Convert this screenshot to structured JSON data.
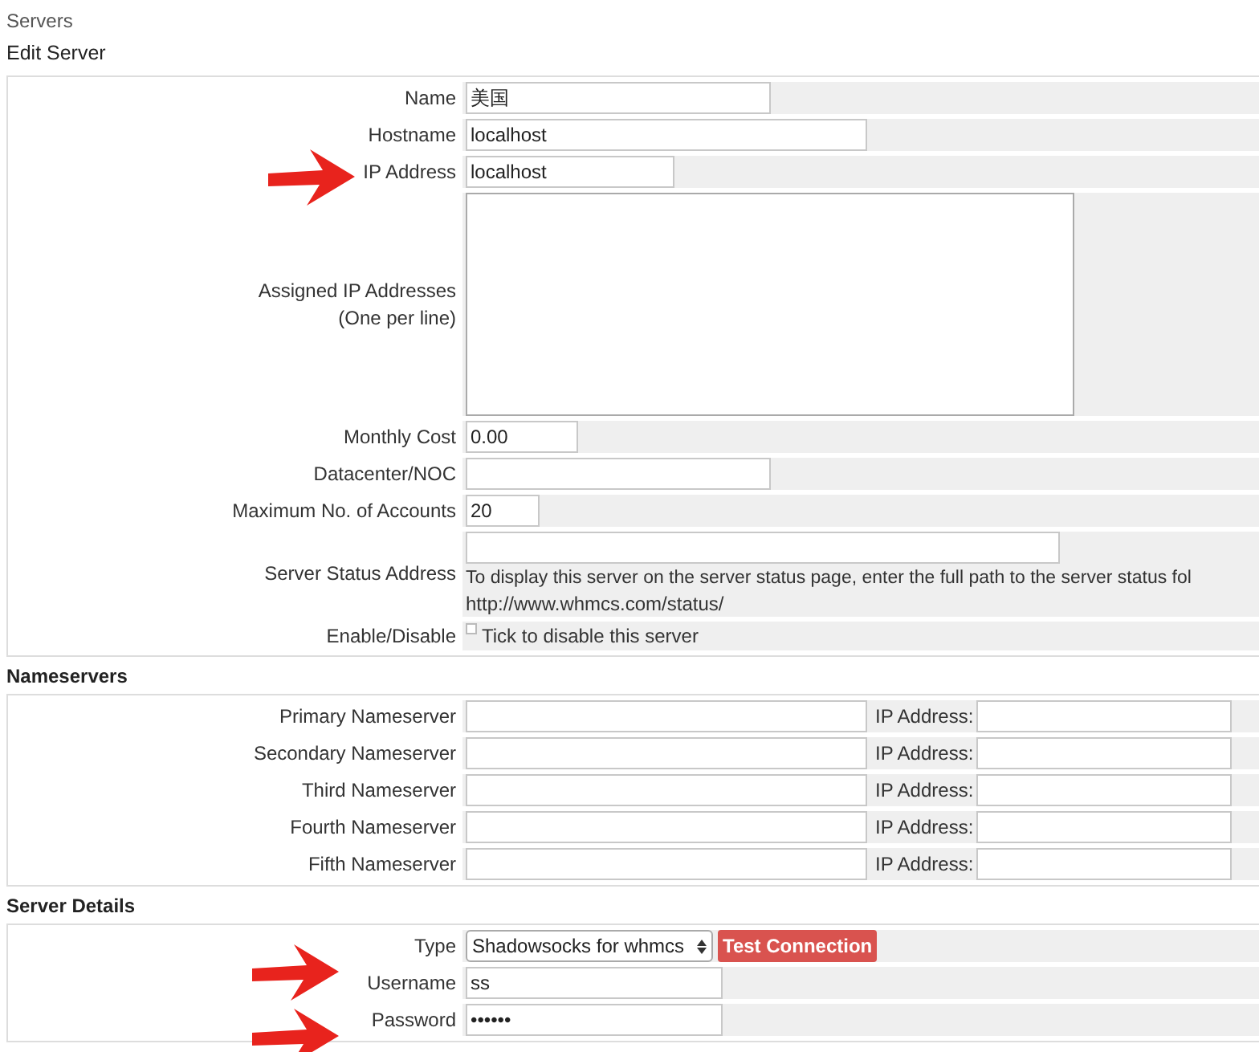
{
  "breadcrumb": "Servers",
  "section_title": "Edit Server",
  "server_fields": [
    {
      "kind": "text",
      "label": "Name",
      "value": "美国"
    },
    {
      "kind": "text",
      "label": "Hostname",
      "value": "localhost"
    },
    {
      "kind": "text",
      "label": "IP Address",
      "value": "localhost"
    },
    {
      "kind": "textarea",
      "label": "Assigned IP Addresses",
      "note": "(One per line)"
    },
    {
      "kind": "text",
      "label": "Monthly Cost",
      "value": "0.00"
    },
    {
      "kind": "text",
      "label": "Datacenter/NOC"
    },
    {
      "kind": "text",
      "label": "Maximum No. of Accounts",
      "value": "20"
    },
    {
      "kind": "help",
      "label": "Server Status Address",
      "help": "To display this server on the server status page, enter the full path to the server status fol",
      "link": "http://www.whmcs.com/status/"
    },
    {
      "kind": "checkbox",
      "label": "Enable/Disable",
      "checked": false,
      "text": "Tick to disable this server"
    }
  ],
  "nameservers_title": "Nameservers",
  "nameservers": [
    {
      "label": "Primary Nameserver",
      "ip_label": "IP Address:"
    },
    {
      "label": "Secondary Nameserver",
      "ip_label": "IP Address:"
    },
    {
      "label": "Third Nameserver",
      "ip_label": "IP Address:"
    },
    {
      "label": "Fourth Nameserver",
      "ip_label": "IP Address:"
    },
    {
      "label": "Fifth Nameserver",
      "ip_label": "IP Address:"
    }
  ],
  "details_title": "Server Details",
  "details": [
    {
      "kind": "select",
      "label": "Type",
      "value": "Shadowsocks for whmcs",
      "button": "Test Connection"
    },
    {
      "kind": "text",
      "label": "Username",
      "value": "ss"
    },
    {
      "kind": "text",
      "label": "Password",
      "value": "••••••"
    }
  ]
}
